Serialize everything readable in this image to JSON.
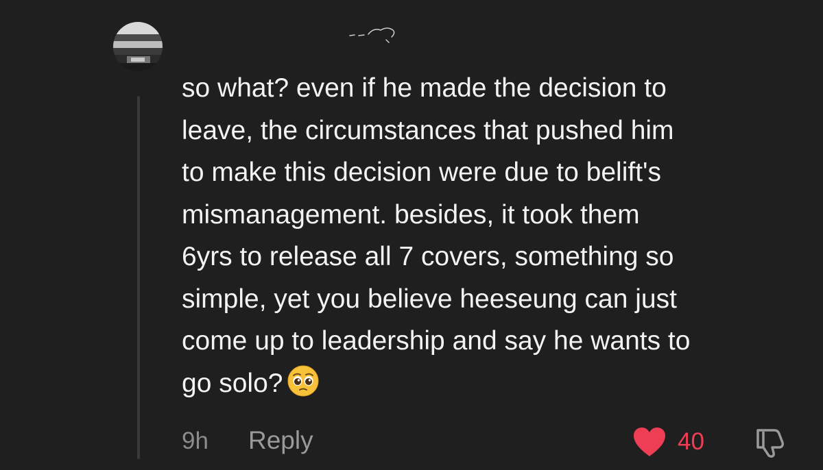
{
  "comment": {
    "text": "so what? even if he made the decision to\nleave, the circumstances that pushed him\nto make this decision were due to belift's\nmismanagement. besides, it took them\n6yrs to release all 7 covers, something so\nsimple, yet you believe heeseung can just\ncome up to leadership and say he wants to\ngo solo?",
    "emoji": "pleading-face"
  },
  "footer": {
    "timestamp": "9h",
    "reply_label": "Reply",
    "like_count": "40"
  },
  "colors": {
    "background": "#1f1f1f",
    "text": "#f3f3f3",
    "muted": "#8c8c8c",
    "like": "#ee3e56"
  },
  "icons": {
    "like": "heart-icon",
    "dislike": "thumbs-down-icon"
  }
}
